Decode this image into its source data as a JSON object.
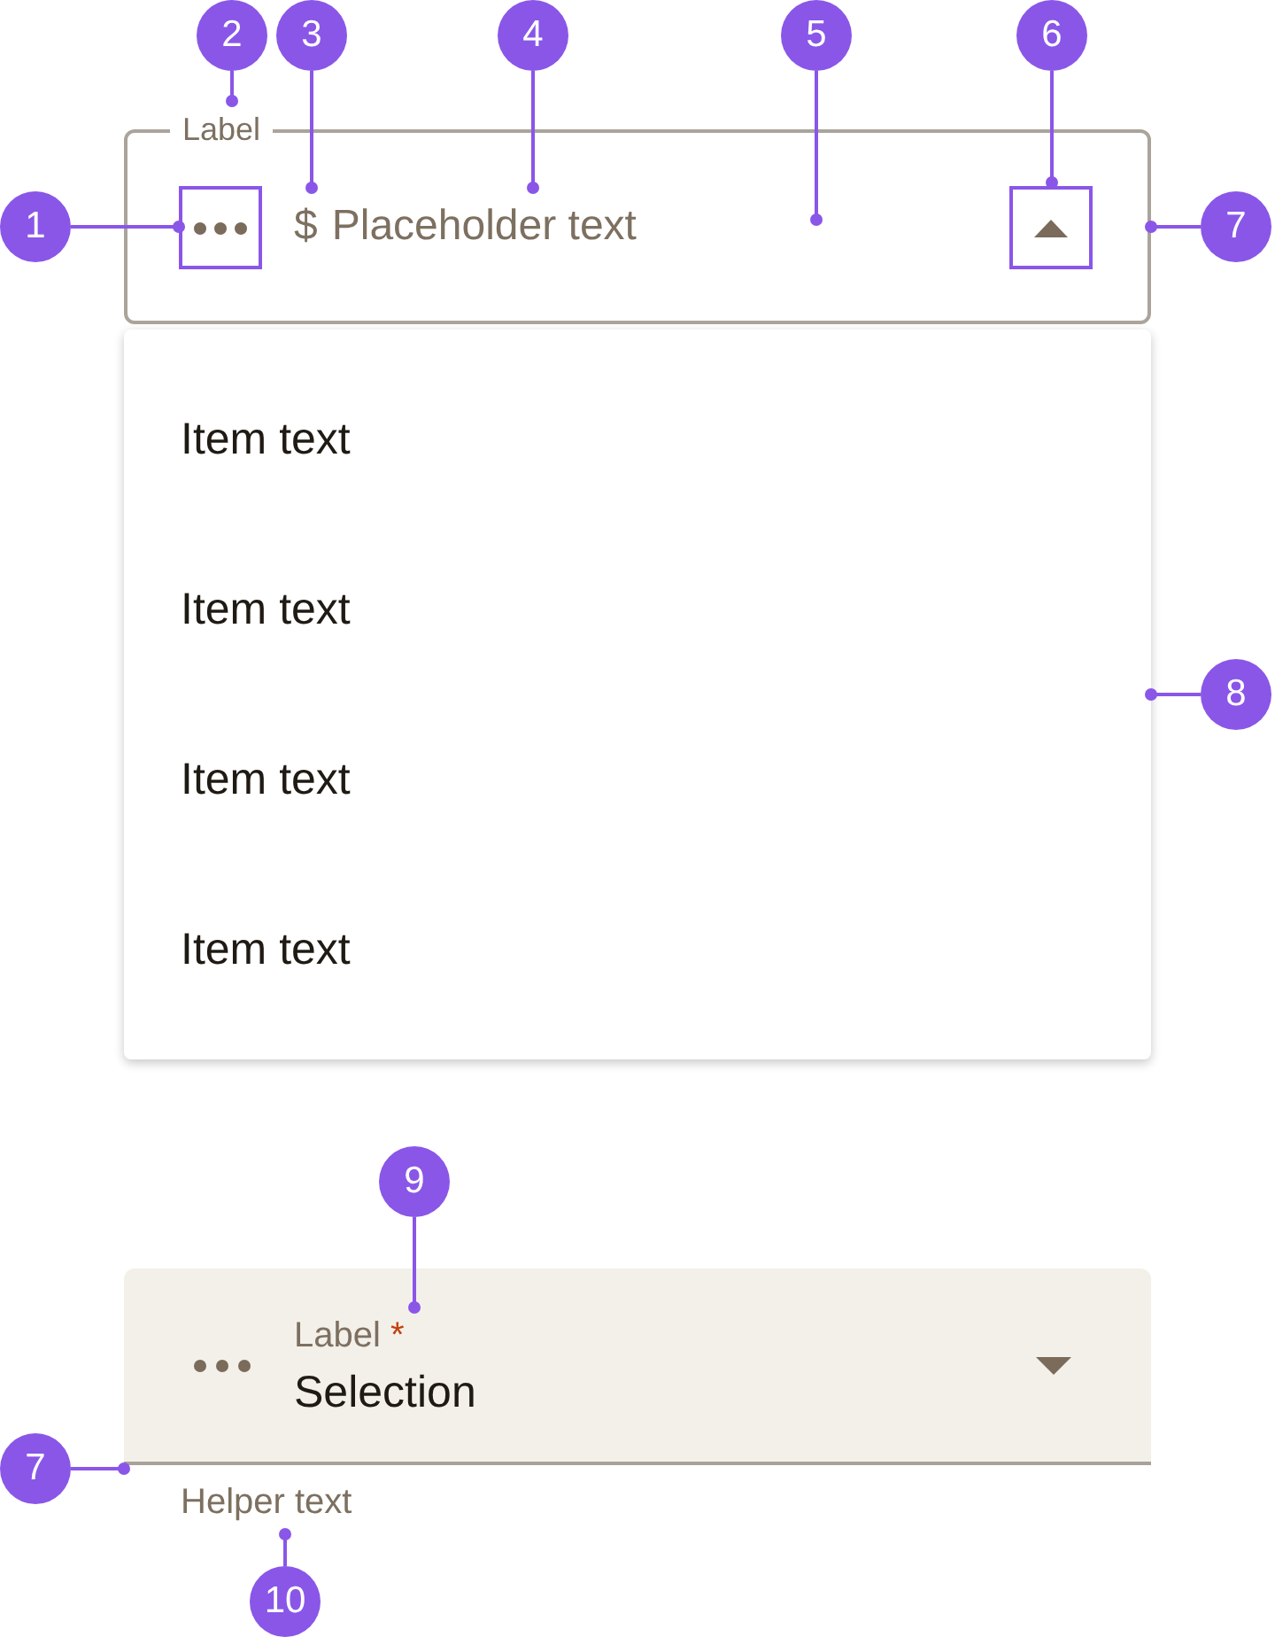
{
  "outlined_field": {
    "label": "Label",
    "prefix": "$",
    "placeholder": "Placeholder text",
    "expanded": true
  },
  "menu": {
    "items": [
      {
        "label": "Item text"
      },
      {
        "label": "Item text"
      },
      {
        "label": "Item text"
      },
      {
        "label": "Item text"
      }
    ]
  },
  "filled_field": {
    "label": "Label",
    "required_mark": "*",
    "value": "Selection",
    "expanded": false,
    "helper_text": "Helper text"
  },
  "callouts": [
    {
      "number": "1"
    },
    {
      "number": "2"
    },
    {
      "number": "3"
    },
    {
      "number": "4"
    },
    {
      "number": "5"
    },
    {
      "number": "6"
    },
    {
      "number": "7"
    },
    {
      "number": "8"
    },
    {
      "number": "9"
    },
    {
      "number": "7"
    },
    {
      "number": "10"
    }
  ]
}
